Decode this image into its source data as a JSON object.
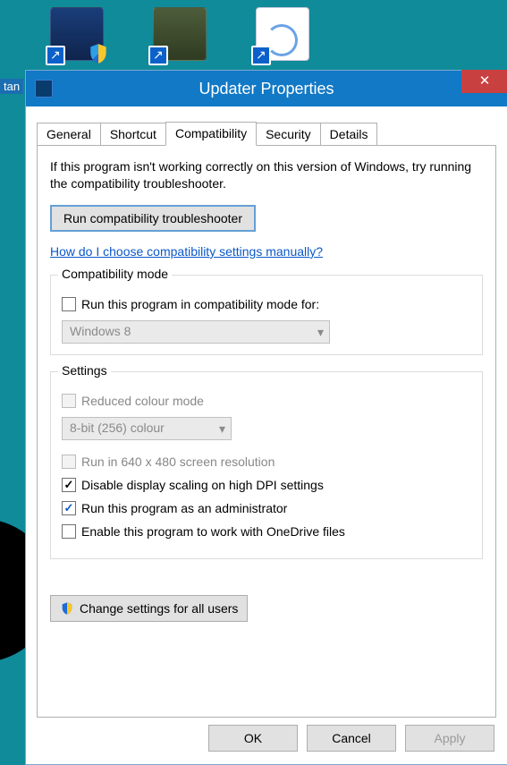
{
  "desktop": {
    "label_fragment": "tan"
  },
  "window": {
    "title": "Updater Properties",
    "close_glyph": "✕"
  },
  "tabs": {
    "general": "General",
    "shortcut": "Shortcut",
    "compatibility": "Compatibility",
    "security": "Security",
    "details": "Details",
    "active": "compatibility"
  },
  "compat": {
    "intro": "If this program isn't working correctly on this version of Windows, try running the compatibility troubleshooter.",
    "run_troubleshooter_btn": "Run compatibility troubleshooter",
    "help_link": "How do I choose compatibility settings manually?",
    "mode_group": {
      "legend": "Compatibility mode",
      "checkbox_label": "Run this program in compatibility mode for:",
      "combo_value": "Windows 8"
    },
    "settings_group": {
      "legend": "Settings",
      "reduced_colour_label": "Reduced colour mode",
      "colour_combo_value": "8-bit (256) colour",
      "run_640_label": "Run in 640 x 480 screen resolution",
      "disable_dpi_label": "Disable display scaling on high DPI settings",
      "run_admin_label": "Run this program as an administrator",
      "onedrive_label": "Enable this program to work with OneDrive files"
    },
    "change_all_users_btn": "Change settings for all users"
  },
  "buttons": {
    "ok": "OK",
    "cancel": "Cancel",
    "apply": "Apply"
  }
}
